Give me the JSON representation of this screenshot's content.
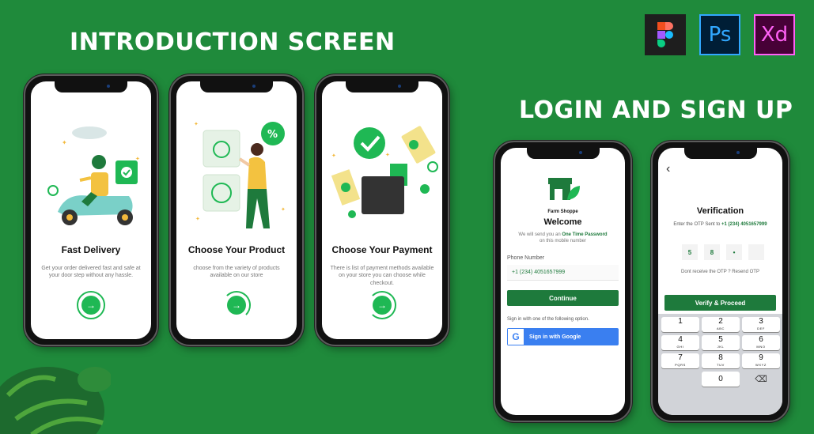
{
  "headings": {
    "intro": "INTRODUCTION SCREEN",
    "login": "LOGIN AND SIGN UP"
  },
  "tools": {
    "ps": "Ps",
    "xd": "Xd"
  },
  "intro_screens": [
    {
      "title": "Fast Delivery",
      "description": "Get your order delivered fast and safe at your door step without any hassle."
    },
    {
      "title": "Choose Your Product",
      "description": "choose from the variety of products available on our store"
    },
    {
      "title": "Choose Your Payment",
      "description": "There is list of payment methods available on your store you can choose while checkout."
    }
  ],
  "next_arrow": "→",
  "login": {
    "brand": "Farm Shoppe",
    "welcome": "Welcome",
    "otp_line1_prefix": "We will send you an ",
    "otp_line1_bold": "One Time Password",
    "otp_line2": "on this mobile number",
    "phone_label": "Phone Number",
    "phone_value": "+1 (234) 4051657999",
    "continue": "Continue",
    "signin_with": "Sign in with one of the following option.",
    "google": "Sign in with Google"
  },
  "verify": {
    "back": "‹",
    "title": "Verification",
    "sent_prefix": "Enter the OTP Sent to ",
    "sent_number": "+1 (234) 4051657999",
    "otp_digits": [
      "5",
      "8",
      "•",
      ""
    ],
    "resend": "Dont receive the OTP ? Resend OTP",
    "proceed": "Verify & Proceed",
    "keys": [
      {
        "n": "1",
        "s": ""
      },
      {
        "n": "2",
        "s": "ABC"
      },
      {
        "n": "3",
        "s": "DEF"
      },
      {
        "n": "4",
        "s": "GHI"
      },
      {
        "n": "5",
        "s": "JKL"
      },
      {
        "n": "6",
        "s": "MNO"
      },
      {
        "n": "7",
        "s": "PQRS"
      },
      {
        "n": "8",
        "s": "TUV"
      },
      {
        "n": "9",
        "s": "WXYZ"
      },
      {
        "n": "0",
        "s": ""
      }
    ],
    "backspace": "⌫"
  }
}
